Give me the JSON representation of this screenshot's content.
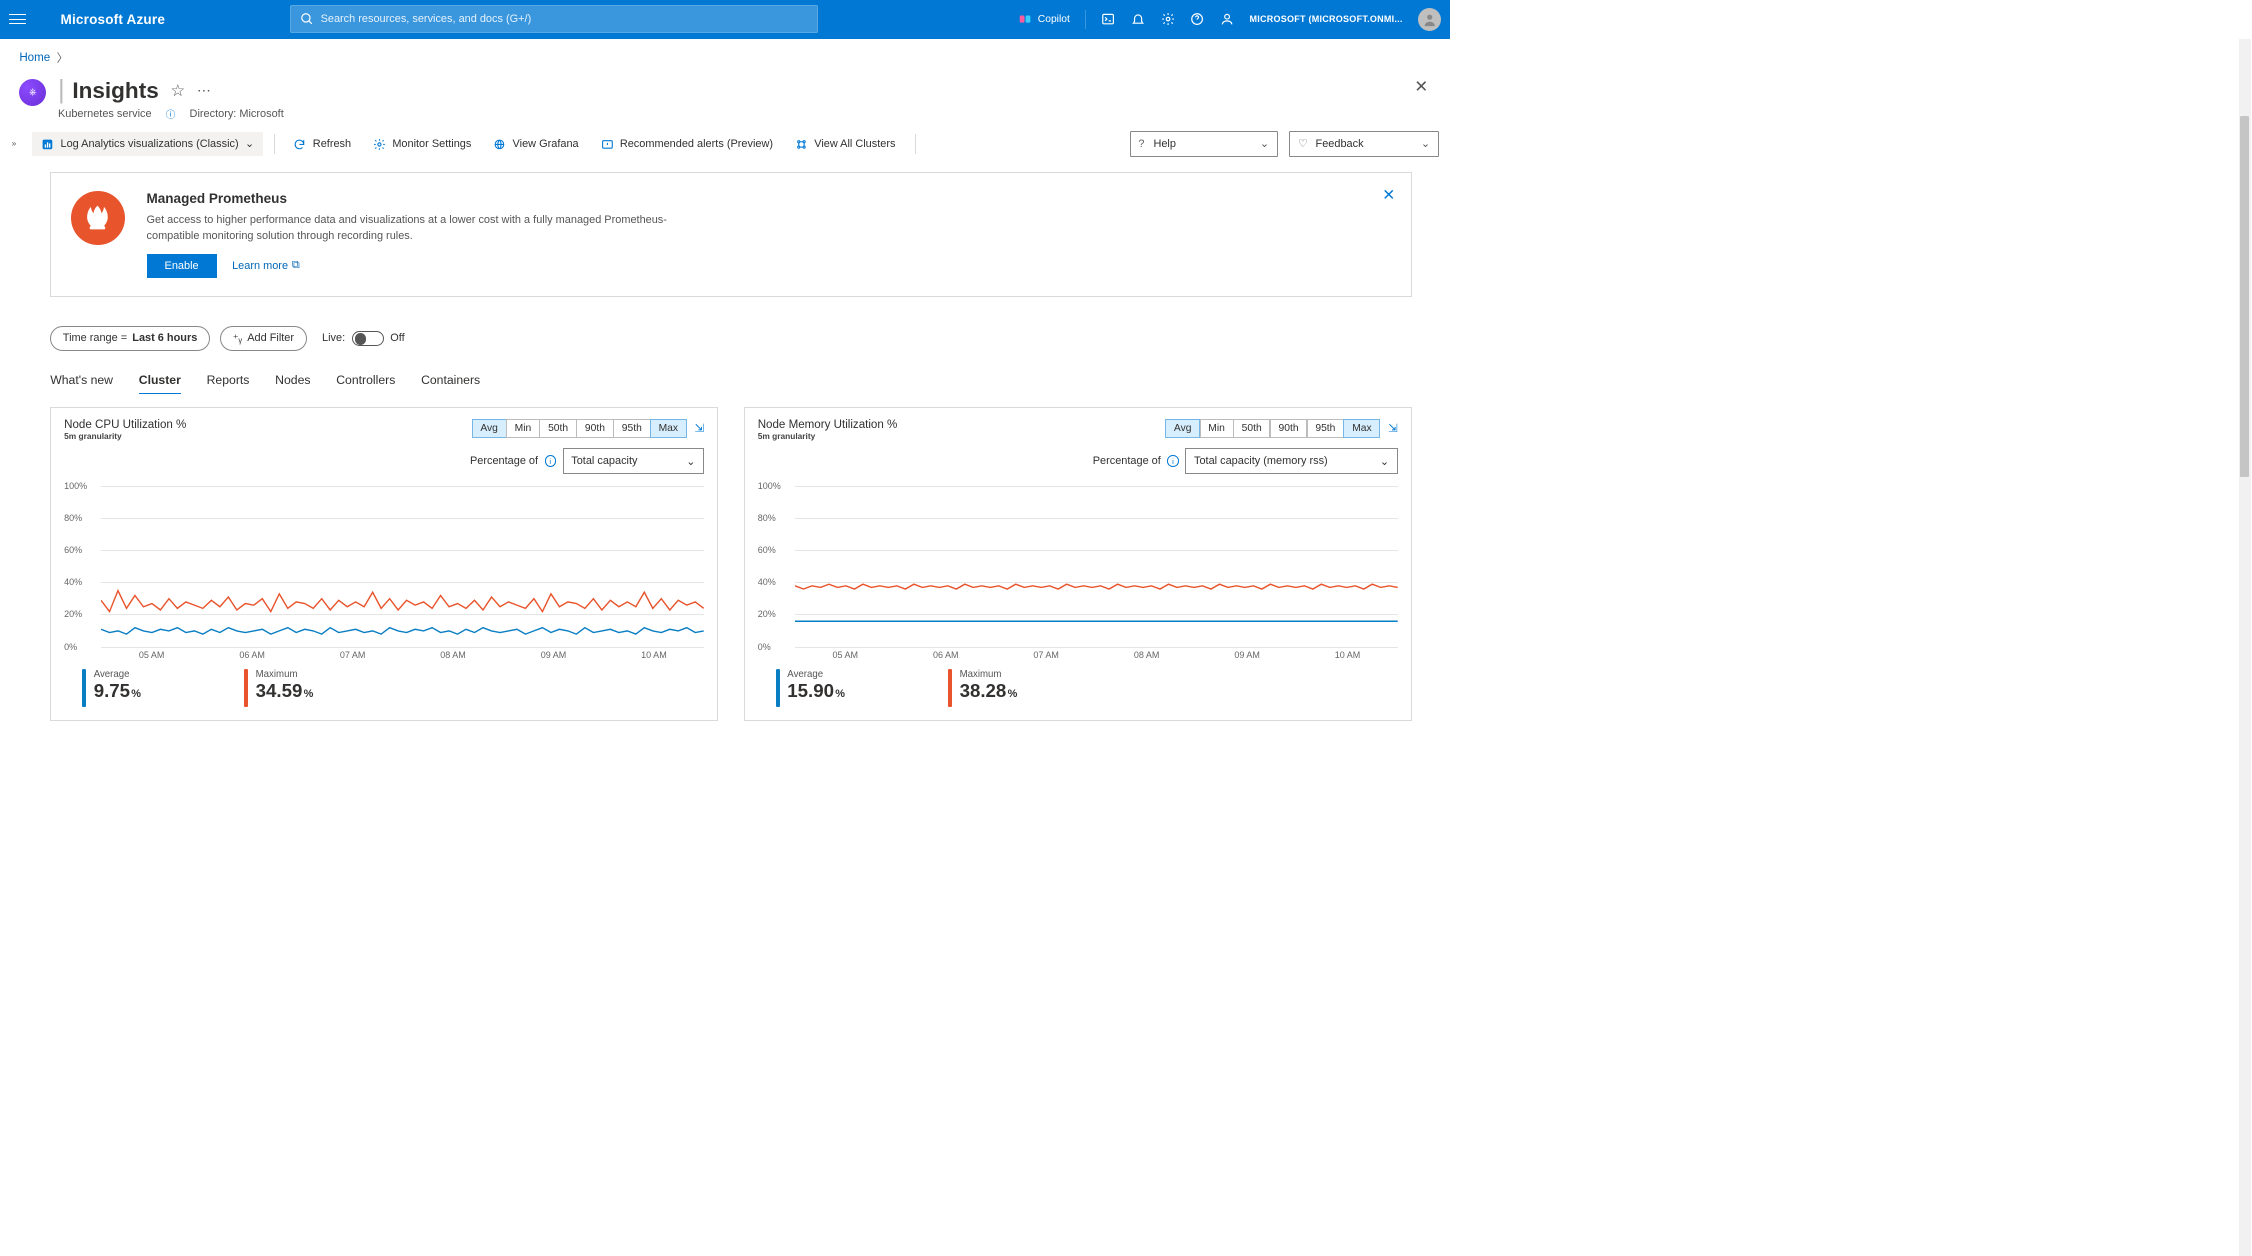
{
  "topbar": {
    "brand": "Microsoft Azure",
    "search_placeholder": "Search resources, services, and docs (G+/)",
    "copilot": "Copilot",
    "account": "MICROSOFT (MICROSOFT.ONMI..."
  },
  "breadcrumb": {
    "home": "Home"
  },
  "page": {
    "title": "Insights",
    "subtype": "Kubernetes service",
    "directory_label": "Directory: Microsoft"
  },
  "toolbar": {
    "mode": "Log Analytics visualizations (Classic)",
    "refresh": "Refresh",
    "monitor_settings": "Monitor Settings",
    "view_grafana": "View Grafana",
    "recommended_alerts": "Recommended alerts (Preview)",
    "view_all_clusters": "View All Clusters",
    "help": "Help",
    "feedback": "Feedback"
  },
  "banner": {
    "title": "Managed Prometheus",
    "body": "Get access to higher performance data and visualizations at a lower cost with a fully managed Prometheus-compatible monitoring solution through recording rules.",
    "enable": "Enable",
    "learn_more": "Learn more"
  },
  "filters": {
    "time_range_prefix": "Time range = ",
    "time_range_value": "Last 6 hours",
    "add_filter": "Add Filter",
    "live_label": "Live:",
    "live_state": "Off"
  },
  "tabs": [
    "What's new",
    "Cluster",
    "Reports",
    "Nodes",
    "Controllers",
    "Containers"
  ],
  "active_tab": "Cluster",
  "agg_options": [
    "Avg",
    "Min",
    "50th",
    "90th",
    "95th",
    "Max"
  ],
  "selected_aggs": [
    "Avg",
    "Max"
  ],
  "x_ticks": [
    "05 AM",
    "06 AM",
    "07 AM",
    "08 AM",
    "09 AM",
    "10 AM"
  ],
  "y_ticks": [
    "100%",
    "80%",
    "60%",
    "40%",
    "20%",
    "0%"
  ],
  "cards": {
    "cpu": {
      "title": "Node CPU Utilization %",
      "granularity": "5m granularity",
      "percentage_of_label": "Percentage of",
      "percentage_of_value": "Total capacity",
      "stats": {
        "avg_label": "Average",
        "avg": "9.75",
        "max_label": "Maximum",
        "max": "34.59",
        "unit": "%"
      }
    },
    "mem": {
      "title": "Node Memory Utilization %",
      "granularity": "5m granularity",
      "percentage_of_label": "Percentage of",
      "percentage_of_value": "Total capacity (memory rss)",
      "stats": {
        "avg_label": "Average",
        "avg": "15.90",
        "max_label": "Maximum",
        "max": "38.28",
        "unit": "%"
      }
    }
  },
  "chart_data": [
    {
      "type": "line",
      "title": "Node CPU Utilization %",
      "xlabel": "",
      "ylabel": "",
      "ylim": [
        0,
        100
      ],
      "x_categories": [
        "05 AM",
        "06 AM",
        "07 AM",
        "08 AM",
        "09 AM",
        "10 AM"
      ],
      "series": [
        {
          "name": "Average",
          "color": "#0a7ec3",
          "values": [
            11,
            9,
            10,
            8,
            12,
            10,
            9,
            11,
            10,
            12,
            9,
            10,
            8,
            11,
            9,
            12,
            10,
            9,
            10,
            11,
            8,
            10,
            12,
            9,
            11,
            10,
            8,
            12,
            9,
            10,
            11,
            9,
            10,
            8,
            12,
            10,
            9,
            11,
            10,
            12,
            9,
            10,
            8,
            11,
            9,
            12,
            10,
            9,
            10,
            11,
            8,
            10,
            12,
            9,
            11,
            10,
            8,
            12,
            9,
            10,
            11,
            9,
            10,
            8,
            12,
            10,
            9,
            11,
            10,
            12,
            9,
            10
          ]
        },
        {
          "name": "Maximum",
          "color": "#e8542c",
          "values": [
            29,
            22,
            35,
            24,
            32,
            25,
            27,
            23,
            30,
            24,
            28,
            26,
            24,
            29,
            25,
            31,
            23,
            27,
            26,
            30,
            22,
            33,
            24,
            28,
            27,
            24,
            30,
            23,
            29,
            25,
            28,
            25,
            34,
            24,
            30,
            23,
            29,
            26,
            28,
            24,
            32,
            25,
            27,
            24,
            29,
            23,
            31,
            25,
            28,
            26,
            24,
            30,
            22,
            33,
            25,
            28,
            27,
            24,
            30,
            23,
            29,
            25,
            28,
            25,
            34,
            24,
            30,
            23,
            29,
            26,
            28,
            24
          ]
        }
      ]
    },
    {
      "type": "line",
      "title": "Node Memory Utilization %",
      "xlabel": "",
      "ylabel": "",
      "ylim": [
        0,
        100
      ],
      "x_categories": [
        "05 AM",
        "06 AM",
        "07 AM",
        "08 AM",
        "09 AM",
        "10 AM"
      ],
      "series": [
        {
          "name": "Average",
          "color": "#0a7ec3",
          "values": [
            16,
            16,
            16,
            16,
            16,
            16,
            16,
            16,
            16,
            16,
            16,
            16,
            16,
            16,
            16,
            16,
            16,
            16,
            16,
            16,
            16,
            16,
            16,
            16,
            16,
            16,
            16,
            16,
            16,
            16,
            16,
            16,
            16,
            16,
            16,
            16,
            16,
            16,
            16,
            16,
            16,
            16,
            16,
            16,
            16,
            16,
            16,
            16,
            16,
            16,
            16,
            16,
            16,
            16,
            16,
            16,
            16,
            16,
            16,
            16,
            16,
            16,
            16,
            16,
            16,
            16,
            16,
            16,
            16,
            16,
            16,
            16
          ]
        },
        {
          "name": "Maximum",
          "color": "#e8542c",
          "values": [
            38,
            36,
            38,
            37,
            39,
            37,
            38,
            36,
            39,
            37,
            38,
            37,
            38,
            36,
            39,
            37,
            38,
            37,
            38,
            36,
            39,
            37,
            38,
            37,
            38,
            36,
            39,
            37,
            38,
            37,
            38,
            36,
            39,
            37,
            38,
            37,
            38,
            36,
            39,
            37,
            38,
            37,
            38,
            36,
            39,
            37,
            38,
            37,
            38,
            36,
            39,
            37,
            38,
            37,
            38,
            36,
            39,
            37,
            38,
            37,
            38,
            36,
            39,
            37,
            38,
            37,
            38,
            36,
            39,
            37,
            38,
            37
          ]
        }
      ]
    }
  ]
}
